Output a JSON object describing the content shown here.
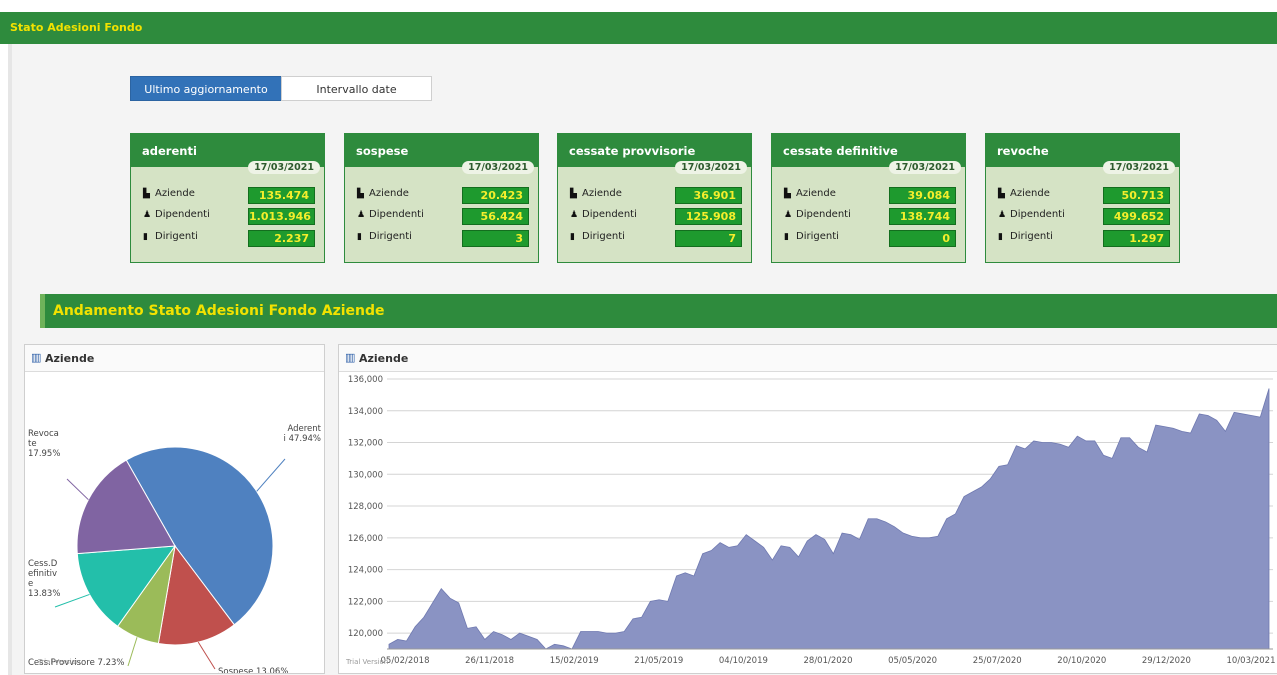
{
  "app": {
    "title": "Stato Adesioni Fondo"
  },
  "tabs": [
    {
      "label": "Ultimo aggiornamento",
      "active": true
    },
    {
      "label": "Intervallo date",
      "active": false
    }
  ],
  "row_labels": [
    "Aziende",
    "Dipendenti",
    "Dirigenti"
  ],
  "row_icons": [
    "factory-icon",
    "users-icon",
    "manager-icon"
  ],
  "cards": [
    {
      "title": "aderenti",
      "date": "17/03/2021",
      "values": [
        "135.474",
        "1.013.946",
        "2.237"
      ]
    },
    {
      "title": "sospese",
      "date": "17/03/2021",
      "values": [
        "20.423",
        "56.424",
        "3"
      ]
    },
    {
      "title": "cessate provvisorie",
      "date": "17/03/2021",
      "values": [
        "36.901",
        "125.908",
        "7"
      ]
    },
    {
      "title": "cessate definitive",
      "date": "17/03/2021",
      "values": [
        "39.084",
        "138.744",
        "0"
      ]
    },
    {
      "title": "revoche",
      "date": "17/03/2021",
      "values": [
        "50.713",
        "499.652",
        "1.297"
      ]
    }
  ],
  "section": {
    "title": "Andamento Stato Adesioni Fondo Aziende"
  },
  "pie_panel": {
    "title": "Aziende",
    "trial": "Trial Version"
  },
  "area_panel": {
    "title": "Aziende",
    "trial": "Trial Version"
  },
  "colors": {
    "green": "#2e8b3d",
    "yellow": "#f2e200",
    "blue": "#3272b8",
    "area": "#8a93c3"
  },
  "chart_data": [
    {
      "type": "pie",
      "title": "Aziende",
      "slices": [
        {
          "name": "Aderenti",
          "label_lines": [
            "Aderent",
            "i 47.94%"
          ],
          "value": 47.94,
          "color": "#4f81c0"
        },
        {
          "name": "Sospese",
          "label_lines": [
            "Sospese 13.06%"
          ],
          "value": 13.06,
          "color": "#c0504d"
        },
        {
          "name": "Cess.Provvisore",
          "label_lines": [
            "Cess.Provvisore 7.23%"
          ],
          "value": 7.23,
          "color": "#9bbb59"
        },
        {
          "name": "Cess.Definitive",
          "label_lines": [
            "Cess.D",
            "efinitiv",
            "e",
            "13.83%"
          ],
          "value": 13.83,
          "color": "#23bfaa"
        },
        {
          "name": "Revocate",
          "label_lines": [
            "Revoca",
            "te",
            "17.95%"
          ],
          "value": 17.95,
          "color": "#8064a2"
        }
      ]
    },
    {
      "type": "area",
      "title": "Aziende",
      "ylim": [
        119000,
        136000
      ],
      "y_ticks": [
        120000,
        122000,
        124000,
        126000,
        128000,
        130000,
        132000,
        134000,
        136000
      ],
      "y_tick_labels": [
        "120,000",
        "122,000",
        "124,000",
        "126,000",
        "128,000",
        "130,000",
        "132,000",
        "134,000",
        "136,000"
      ],
      "x_range": [
        "05/02/2018",
        "17/03/2021"
      ],
      "x_tick_labels": [
        "05/02/2018",
        "26/11/2018",
        "15/02/2019",
        "21/05/2019",
        "04/10/2019",
        "28/01/2020",
        "05/05/2020",
        "25/07/2020",
        "20/10/2020",
        "29/12/2020",
        "10/03/2021"
      ],
      "grid": true,
      "color": "#8a93c3",
      "values": [
        119300,
        119600,
        119500,
        120400,
        121000,
        121900,
        122800,
        122200,
        121900,
        120300,
        120400,
        119600,
        120100,
        119900,
        119600,
        120000,
        119800,
        119600,
        119000,
        119300,
        119200,
        119000,
        120100,
        120100,
        120100,
        120000,
        120000,
        120100,
        120900,
        121000,
        122000,
        122100,
        122000,
        123600,
        123800,
        123600,
        125000,
        125200,
        125700,
        125400,
        125500,
        126200,
        125800,
        125400,
        124600,
        125500,
        125400,
        124800,
        125800,
        126200,
        125900,
        125000,
        126300,
        126200,
        125900,
        127200,
        127200,
        127000,
        126700,
        126300,
        126100,
        126000,
        126000,
        126100,
        127200,
        127500,
        128600,
        128900,
        129200,
        129700,
        130500,
        130600,
        131800,
        131600,
        132100,
        132000,
        132000,
        131900,
        131700,
        132400,
        132100,
        132100,
        131200,
        131000,
        132300,
        132300,
        131700,
        131400,
        133100,
        133000,
        132900,
        132700,
        132600,
        133800,
        133700,
        133400,
        132700,
        133900,
        133800,
        133700,
        133600,
        135400
      ]
    }
  ]
}
